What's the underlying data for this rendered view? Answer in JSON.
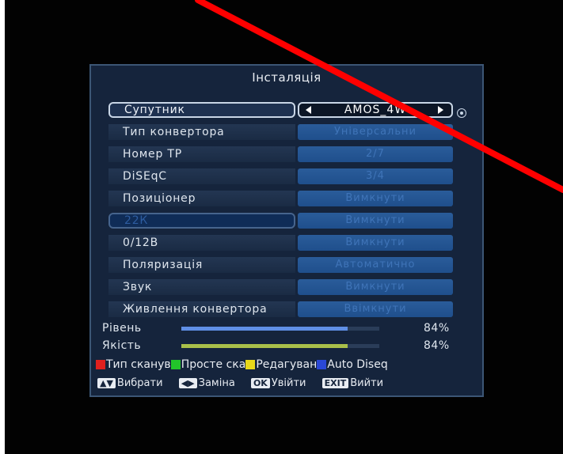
{
  "title": "Інсталяція",
  "rows": [
    {
      "label": "Супутник",
      "value": "AMOS_4W"
    },
    {
      "label": "Тип конвертора",
      "value": "Універсальни"
    },
    {
      "label": "Номер ТР",
      "value": "2/7"
    },
    {
      "label": "DiSEqC",
      "value": "3/4"
    },
    {
      "label": "Позиціонер",
      "value": "Вимкнути"
    },
    {
      "label": "22К",
      "value": "Вимкнути"
    },
    {
      "label": "0/12В",
      "value": "Вимкнути"
    },
    {
      "label": "Поляризація",
      "value": "Автоматично"
    },
    {
      "label": "Звук",
      "value": "Вимкнути"
    },
    {
      "label": "Живлення конвертора",
      "value": "Ввімкнути"
    }
  ],
  "signal": {
    "level_label": "Рівень",
    "level_value": "84%",
    "level_fraction": 0.84,
    "quality_label": "Якість",
    "quality_value": "84%",
    "quality_fraction": 0.84
  },
  "color_keys": [
    {
      "color": "#e0201e",
      "label": "Тип сканув"
    },
    {
      "color": "#22c52a",
      "label": "Просте ска"
    },
    {
      "color": "#e8d81a",
      "label": "Редагуван"
    },
    {
      "color": "#2a48d6",
      "label": "Auto Diseq"
    }
  ],
  "hints": [
    {
      "key": "▲▼",
      "label": "Вибрати"
    },
    {
      "key": "◀▶",
      "label": "Заміна"
    },
    {
      "key": "OK",
      "label": "Увійти"
    },
    {
      "key": "EXIT",
      "label": "Вийти"
    }
  ],
  "colors": {
    "panel_bg": "#15243c",
    "value_bg": "#2a5c9a",
    "level_bar": "#5f8fe6",
    "quality_bar": "#a9c04a",
    "overlay_line": "#ff0000"
  }
}
